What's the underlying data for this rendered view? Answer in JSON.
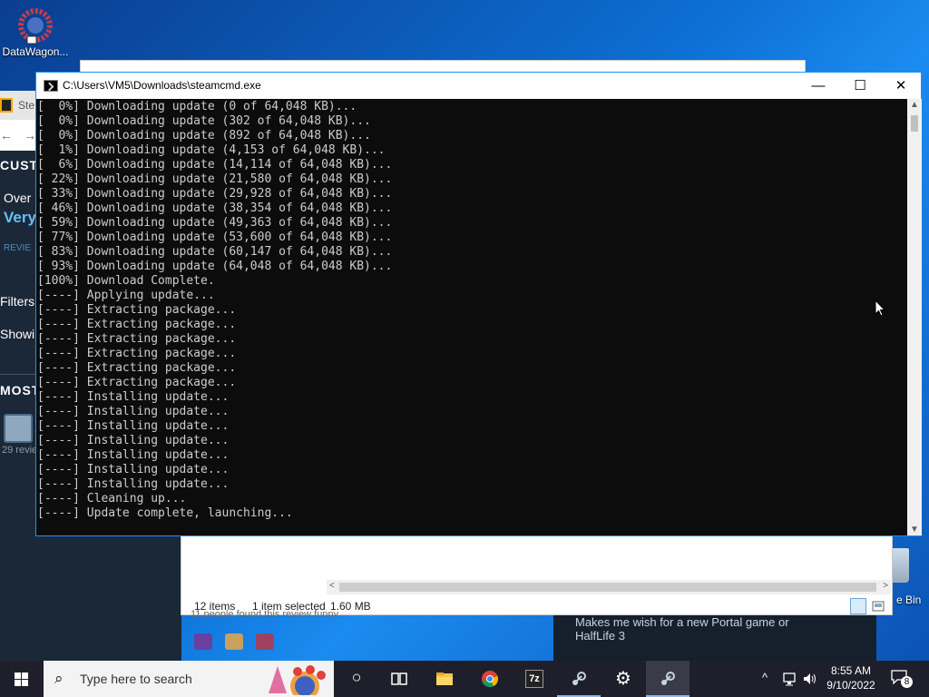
{
  "desktop": {
    "icon_datawagon": "DataWagon...",
    "icon_recycle_bin": "e Bin"
  },
  "steam_window": {
    "tab_title": "Ste",
    "nav_back": "←",
    "nav_forward": "→",
    "section_custom": "CUSTO",
    "overall_label": "Over",
    "overall_value": "Very",
    "reviews_label": "REVIE",
    "filters_label": "Filters",
    "showing_label": "Showi",
    "most_label": "MOST",
    "review_count": "29 revie"
  },
  "explorer": {
    "items_count": "12 items",
    "selection": "1 item selected",
    "selection_size": "1.60 MB",
    "scroll_left": "<",
    "scroll_right": ">"
  },
  "review_page": {
    "helpful_text": "11 people found this review funny",
    "review_text_1": "Makes me wish for a new Portal game or",
    "review_text_2": "HalfLife 3"
  },
  "console": {
    "title": "C:\\Users\\VM5\\Downloads\\steamcmd.exe",
    "minimize": "—",
    "maximize": "☐",
    "close": "✕",
    "lines": [
      "[  0%] Downloading update (0 of 64,048 KB)...",
      "[  0%] Downloading update (302 of 64,048 KB)...",
      "[  0%] Downloading update (892 of 64,048 KB)...",
      "[  1%] Downloading update (4,153 of 64,048 KB)...",
      "[  6%] Downloading update (14,114 of 64,048 KB)...",
      "[ 22%] Downloading update (21,580 of 64,048 KB)...",
      "[ 33%] Downloading update (29,928 of 64,048 KB)...",
      "[ 46%] Downloading update (38,354 of 64,048 KB)...",
      "[ 59%] Downloading update (49,363 of 64,048 KB)...",
      "[ 77%] Downloading update (53,600 of 64,048 KB)...",
      "[ 83%] Downloading update (60,147 of 64,048 KB)...",
      "[ 93%] Downloading update (64,048 of 64,048 KB)...",
      "[100%] Download Complete.",
      "[----] Applying update...",
      "[----] Extracting package...",
      "[----] Extracting package...",
      "[----] Extracting package...",
      "[----] Extracting package...",
      "[----] Extracting package...",
      "[----] Extracting package...",
      "[----] Installing update...",
      "[----] Installing update...",
      "[----] Installing update...",
      "[----] Installing update...",
      "[----] Installing update...",
      "[----] Installing update...",
      "[----] Installing update...",
      "[----] Cleaning up...",
      "[----] Update complete, launching..."
    ],
    "scroll_up": "▲",
    "scroll_down": "▼"
  },
  "taskbar": {
    "search_placeholder": "Type here to search",
    "search_glyph": "⌕",
    "cortana_glyph": "○",
    "sevenzip_label": "7z",
    "settings_glyph": "⚙",
    "tray_chevron": "^",
    "time": "8:55 AM",
    "date": "9/10/2022",
    "notification_count": "8"
  },
  "colors": {
    "console_bg": "#0c0c0c",
    "console_text": "#cccccc",
    "taskbar_bg": "#1f1f2b",
    "steam_bg": "#1b2838",
    "desktop_blue": "#0d6fd4"
  }
}
